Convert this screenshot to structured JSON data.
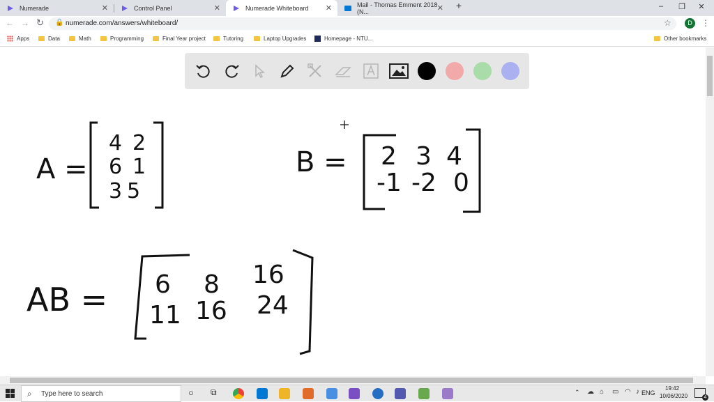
{
  "browser": {
    "tabs": [
      {
        "label": "Numerade"
      },
      {
        "label": "Control Panel"
      },
      {
        "label": "Numerade Whiteboard"
      },
      {
        "label": "Mail - Thomas Emment 2018 (N..."
      }
    ],
    "url": "numerade.com/answers/whiteboard/",
    "profile_initial": "D",
    "bookmarks": [
      {
        "label": "Apps"
      },
      {
        "label": "Data"
      },
      {
        "label": "Math"
      },
      {
        "label": "Programming"
      },
      {
        "label": "Final Year project"
      },
      {
        "label": "Tutoring"
      },
      {
        "label": "Laptop Upgrades"
      },
      {
        "label": "Homepage - NTU..."
      },
      {
        "label": "Other bookmarks"
      }
    ]
  },
  "whiteboard": {
    "tools": [
      "undo-icon",
      "redo-icon",
      "select-icon",
      "pen-icon",
      "tools-icon",
      "eraser-icon",
      "text-icon",
      "image-icon"
    ],
    "colors": [
      "#000000",
      "#f2a9a9",
      "#a9dca9",
      "#aab0f0"
    ],
    "handwriting": {
      "A": {
        "label": "A =",
        "rows": [
          [
            "4",
            "2"
          ],
          [
            "6",
            "1"
          ],
          [
            "3",
            "5"
          ]
        ]
      },
      "B": {
        "label": "B =",
        "rows": [
          [
            "2",
            "3",
            "4"
          ],
          [
            "-1",
            "-2",
            "0"
          ]
        ]
      },
      "AB": {
        "label": "AB =",
        "rows": [
          [
            "6",
            "8",
            "16"
          ],
          [
            "11",
            "16",
            "24"
          ]
        ]
      }
    }
  },
  "taskbar": {
    "search_placeholder": "Type here to search",
    "lang": "ENG",
    "time": "19:42",
    "date": "10/06/2020",
    "notifications": "4"
  }
}
